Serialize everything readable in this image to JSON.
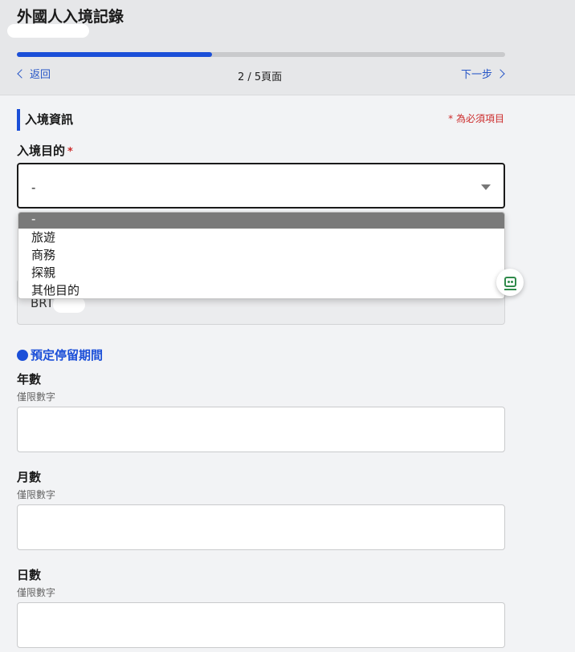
{
  "header": {
    "title": "外國人入境記錄",
    "progress": 0.4,
    "back_label": "返回",
    "next_label": "下一步",
    "page_indicator": "2 / 5頁面"
  },
  "section": {
    "title": "入境資訊",
    "required_note": "* 為必須項目"
  },
  "purpose_field": {
    "label": "入境目的",
    "required_mark": "*",
    "value": "-",
    "options": [
      "-",
      "旅遊",
      "商務",
      "探親",
      "其他目的"
    ]
  },
  "hidden_field": {
    "value": "BRT"
  },
  "stay_period": {
    "title": "預定停留期間",
    "years": {
      "label": "年數",
      "hint": "僅限數字"
    },
    "months": {
      "label": "月數",
      "hint": "僅限數字"
    },
    "days": {
      "label": "日數",
      "hint": "僅限數字"
    }
  },
  "colors": {
    "accent": "#1b4fd8",
    "required": "#cc2b2b"
  }
}
